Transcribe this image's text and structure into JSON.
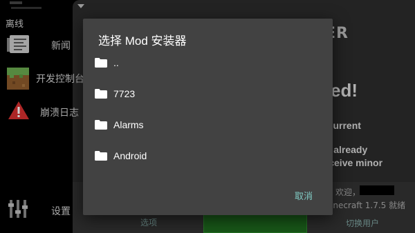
{
  "sidebar": {
    "offline_label": "离线",
    "items": [
      {
        "label": "新闻",
        "icon": "news-icon"
      },
      {
        "label": "开发控制台",
        "icon": "grass-block-icon"
      },
      {
        "label": "崩溃日志",
        "icon": "warning-icon"
      },
      {
        "label": "设置",
        "icon": "settings-sliders-icon"
      }
    ]
  },
  "background": {
    "logo_text": "ER",
    "headline": "ed!",
    "line1": "e current",
    "line2": "en already",
    "line3": "receive minor",
    "welcome": "欢迎，",
    "version": "inecraft 1.7.5 就绪",
    "options_label": "选项",
    "switch_user_label": "切换用户"
  },
  "dialog": {
    "title": "选择 Mod 安装器",
    "items": [
      {
        "label": ".."
      },
      {
        "label": "7723"
      },
      {
        "label": "Alarms"
      },
      {
        "label": "Android"
      }
    ],
    "cancel_label": "取消"
  },
  "colors": {
    "dialog_bg": "#424242",
    "accent": "#80cbc4",
    "warning_red": "#d32f2f"
  }
}
